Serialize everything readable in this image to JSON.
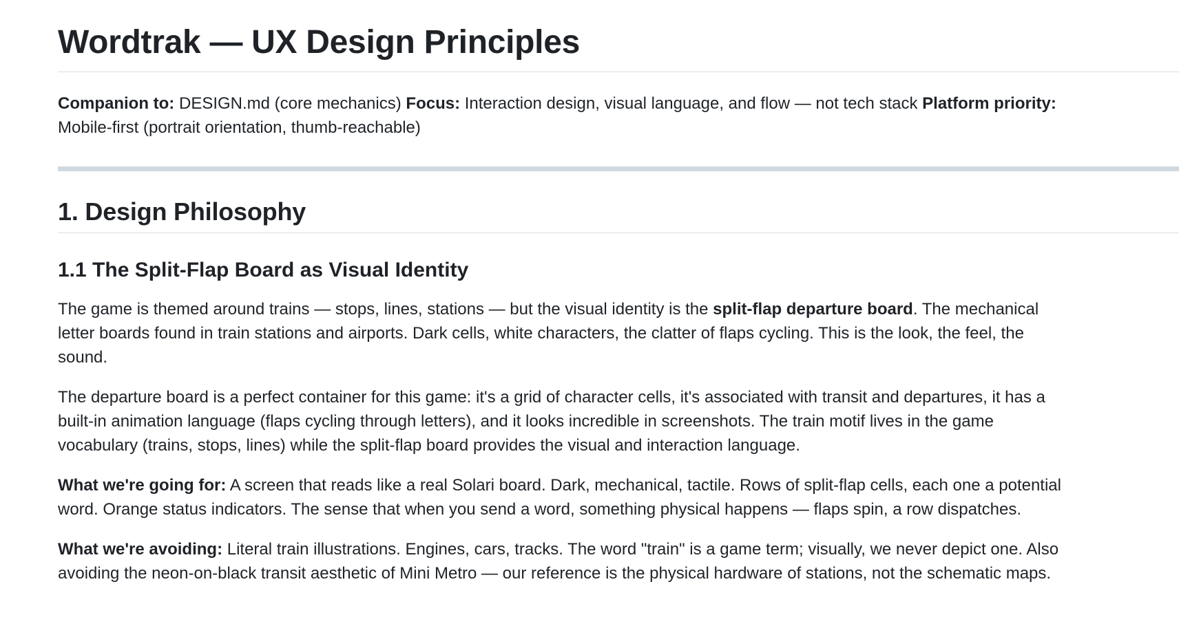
{
  "title": "Wordtrak — UX Design Principles",
  "meta": {
    "companion_label": "Companion to:",
    "companion_value": " DESIGN.md (core mechanics) ",
    "focus_label": "Focus:",
    "focus_value": " Interaction design, visual language, and flow — not tech stack ",
    "platform_label": "Platform priority:",
    "platform_value": " Mobile-first (portrait orientation, thumb-reachable)"
  },
  "section1": {
    "heading": "1. Design Philosophy",
    "sub1": {
      "heading": "1.1 The Split-Flap Board as Visual Identity",
      "p1_before": "The game is themed around trains — stops, lines, stations — but the visual identity is the ",
      "p1_bold": "split-flap departure board",
      "p1_after": ". The mechanical letter boards found in train stations and airports. Dark cells, white characters, the clatter of flaps cycling. This is the look, the feel, the sound.",
      "p2": "The departure board is a perfect container for this game: it's a grid of character cells, it's associated with transit and departures, it has a built-in animation language (flaps cycling through letters), and it looks incredible in screenshots. The train motif lives in the game vocabulary (trains, stops, lines) while the split-flap board provides the visual and interaction language.",
      "p3_label": "What we're going for:",
      "p3_text": " A screen that reads like a real Solari board. Dark, mechanical, tactile. Rows of split-flap cells, each one a potential word. Orange status indicators. The sense that when you send a word, something physical happens — flaps spin, a row dispatches.",
      "p4_label": "What we're avoiding:",
      "p4_text": " Literal train illustrations. Engines, cars, tracks. The word \"train\" is a game term; visually, we never depict one. Also avoiding the neon-on-black transit aesthetic of Mini Metro — our reference is the physical hardware of stations, not the schematic maps."
    }
  }
}
